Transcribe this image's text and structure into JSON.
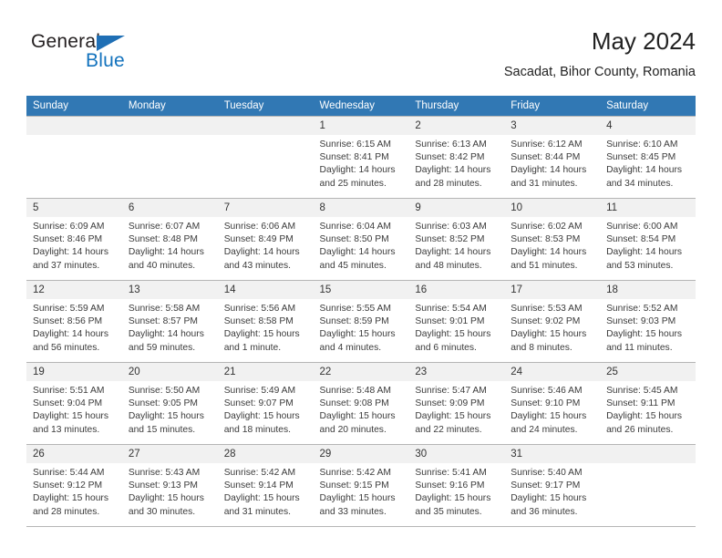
{
  "brand": {
    "name_top": "General",
    "name_bottom": "Blue",
    "accent_color": "#1272bd",
    "triangle_color": "#1f6fb5"
  },
  "header": {
    "title": "May 2024",
    "subtitle": "Sacadat, Bihor County, Romania"
  },
  "theme": {
    "header_bg": "#3178b4",
    "header_text": "#ffffff",
    "daynum_bg": "#f1f1f1",
    "grid_line": "#b5b5b5"
  },
  "weekday_headers": [
    "Sunday",
    "Monday",
    "Tuesday",
    "Wednesday",
    "Thursday",
    "Friday",
    "Saturday"
  ],
  "weeks": [
    [
      {
        "day": "",
        "empty": true
      },
      {
        "day": "",
        "empty": true
      },
      {
        "day": "",
        "empty": true
      },
      {
        "day": "1",
        "sunrise": "Sunrise: 6:15 AM",
        "sunset": "Sunset: 8:41 PM",
        "daylight1": "Daylight: 14 hours",
        "daylight2": "and 25 minutes."
      },
      {
        "day": "2",
        "sunrise": "Sunrise: 6:13 AM",
        "sunset": "Sunset: 8:42 PM",
        "daylight1": "Daylight: 14 hours",
        "daylight2": "and 28 minutes."
      },
      {
        "day": "3",
        "sunrise": "Sunrise: 6:12 AM",
        "sunset": "Sunset: 8:44 PM",
        "daylight1": "Daylight: 14 hours",
        "daylight2": "and 31 minutes."
      },
      {
        "day": "4",
        "sunrise": "Sunrise: 6:10 AM",
        "sunset": "Sunset: 8:45 PM",
        "daylight1": "Daylight: 14 hours",
        "daylight2": "and 34 minutes."
      }
    ],
    [
      {
        "day": "5",
        "sunrise": "Sunrise: 6:09 AM",
        "sunset": "Sunset: 8:46 PM",
        "daylight1": "Daylight: 14 hours",
        "daylight2": "and 37 minutes."
      },
      {
        "day": "6",
        "sunrise": "Sunrise: 6:07 AM",
        "sunset": "Sunset: 8:48 PM",
        "daylight1": "Daylight: 14 hours",
        "daylight2": "and 40 minutes."
      },
      {
        "day": "7",
        "sunrise": "Sunrise: 6:06 AM",
        "sunset": "Sunset: 8:49 PM",
        "daylight1": "Daylight: 14 hours",
        "daylight2": "and 43 minutes."
      },
      {
        "day": "8",
        "sunrise": "Sunrise: 6:04 AM",
        "sunset": "Sunset: 8:50 PM",
        "daylight1": "Daylight: 14 hours",
        "daylight2": "and 45 minutes."
      },
      {
        "day": "9",
        "sunrise": "Sunrise: 6:03 AM",
        "sunset": "Sunset: 8:52 PM",
        "daylight1": "Daylight: 14 hours",
        "daylight2": "and 48 minutes."
      },
      {
        "day": "10",
        "sunrise": "Sunrise: 6:02 AM",
        "sunset": "Sunset: 8:53 PM",
        "daylight1": "Daylight: 14 hours",
        "daylight2": "and 51 minutes."
      },
      {
        "day": "11",
        "sunrise": "Sunrise: 6:00 AM",
        "sunset": "Sunset: 8:54 PM",
        "daylight1": "Daylight: 14 hours",
        "daylight2": "and 53 minutes."
      }
    ],
    [
      {
        "day": "12",
        "sunrise": "Sunrise: 5:59 AM",
        "sunset": "Sunset: 8:56 PM",
        "daylight1": "Daylight: 14 hours",
        "daylight2": "and 56 minutes."
      },
      {
        "day": "13",
        "sunrise": "Sunrise: 5:58 AM",
        "sunset": "Sunset: 8:57 PM",
        "daylight1": "Daylight: 14 hours",
        "daylight2": "and 59 minutes."
      },
      {
        "day": "14",
        "sunrise": "Sunrise: 5:56 AM",
        "sunset": "Sunset: 8:58 PM",
        "daylight1": "Daylight: 15 hours",
        "daylight2": "and 1 minute."
      },
      {
        "day": "15",
        "sunrise": "Sunrise: 5:55 AM",
        "sunset": "Sunset: 8:59 PM",
        "daylight1": "Daylight: 15 hours",
        "daylight2": "and 4 minutes."
      },
      {
        "day": "16",
        "sunrise": "Sunrise: 5:54 AM",
        "sunset": "Sunset: 9:01 PM",
        "daylight1": "Daylight: 15 hours",
        "daylight2": "and 6 minutes."
      },
      {
        "day": "17",
        "sunrise": "Sunrise: 5:53 AM",
        "sunset": "Sunset: 9:02 PM",
        "daylight1": "Daylight: 15 hours",
        "daylight2": "and 8 minutes."
      },
      {
        "day": "18",
        "sunrise": "Sunrise: 5:52 AM",
        "sunset": "Sunset: 9:03 PM",
        "daylight1": "Daylight: 15 hours",
        "daylight2": "and 11 minutes."
      }
    ],
    [
      {
        "day": "19",
        "sunrise": "Sunrise: 5:51 AM",
        "sunset": "Sunset: 9:04 PM",
        "daylight1": "Daylight: 15 hours",
        "daylight2": "and 13 minutes."
      },
      {
        "day": "20",
        "sunrise": "Sunrise: 5:50 AM",
        "sunset": "Sunset: 9:05 PM",
        "daylight1": "Daylight: 15 hours",
        "daylight2": "and 15 minutes."
      },
      {
        "day": "21",
        "sunrise": "Sunrise: 5:49 AM",
        "sunset": "Sunset: 9:07 PM",
        "daylight1": "Daylight: 15 hours",
        "daylight2": "and 18 minutes."
      },
      {
        "day": "22",
        "sunrise": "Sunrise: 5:48 AM",
        "sunset": "Sunset: 9:08 PM",
        "daylight1": "Daylight: 15 hours",
        "daylight2": "and 20 minutes."
      },
      {
        "day": "23",
        "sunrise": "Sunrise: 5:47 AM",
        "sunset": "Sunset: 9:09 PM",
        "daylight1": "Daylight: 15 hours",
        "daylight2": "and 22 minutes."
      },
      {
        "day": "24",
        "sunrise": "Sunrise: 5:46 AM",
        "sunset": "Sunset: 9:10 PM",
        "daylight1": "Daylight: 15 hours",
        "daylight2": "and 24 minutes."
      },
      {
        "day": "25",
        "sunrise": "Sunrise: 5:45 AM",
        "sunset": "Sunset: 9:11 PM",
        "daylight1": "Daylight: 15 hours",
        "daylight2": "and 26 minutes."
      }
    ],
    [
      {
        "day": "26",
        "sunrise": "Sunrise: 5:44 AM",
        "sunset": "Sunset: 9:12 PM",
        "daylight1": "Daylight: 15 hours",
        "daylight2": "and 28 minutes."
      },
      {
        "day": "27",
        "sunrise": "Sunrise: 5:43 AM",
        "sunset": "Sunset: 9:13 PM",
        "daylight1": "Daylight: 15 hours",
        "daylight2": "and 30 minutes."
      },
      {
        "day": "28",
        "sunrise": "Sunrise: 5:42 AM",
        "sunset": "Sunset: 9:14 PM",
        "daylight1": "Daylight: 15 hours",
        "daylight2": "and 31 minutes."
      },
      {
        "day": "29",
        "sunrise": "Sunrise: 5:42 AM",
        "sunset": "Sunset: 9:15 PM",
        "daylight1": "Daylight: 15 hours",
        "daylight2": "and 33 minutes."
      },
      {
        "day": "30",
        "sunrise": "Sunrise: 5:41 AM",
        "sunset": "Sunset: 9:16 PM",
        "daylight1": "Daylight: 15 hours",
        "daylight2": "and 35 minutes."
      },
      {
        "day": "31",
        "sunrise": "Sunrise: 5:40 AM",
        "sunset": "Sunset: 9:17 PM",
        "daylight1": "Daylight: 15 hours",
        "daylight2": "and 36 minutes."
      },
      {
        "day": "",
        "empty": true
      }
    ]
  ]
}
